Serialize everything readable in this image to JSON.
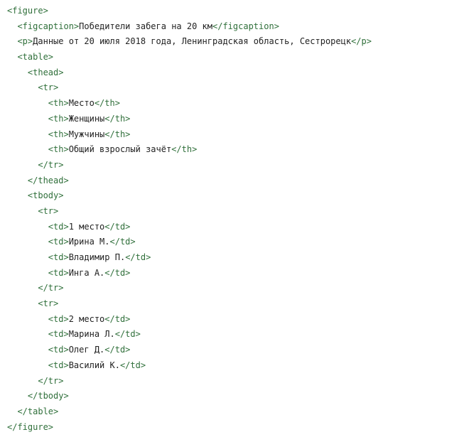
{
  "code": {
    "lines": [
      {
        "indent": 0,
        "open": "<figure>",
        "text": "",
        "close": ""
      },
      {
        "indent": 1,
        "open": "<figcaption>",
        "text": "Победители забега на 20 км",
        "close": "</figcaption>"
      },
      {
        "indent": 1,
        "open": "<p>",
        "text": "Данные от 20 июля 2018 года, Ленинградская область, Сестрорецк",
        "close": "</p>"
      },
      {
        "indent": 1,
        "open": "<table>",
        "text": "",
        "close": ""
      },
      {
        "indent": 2,
        "open": "<thead>",
        "text": "",
        "close": ""
      },
      {
        "indent": 3,
        "open": "<tr>",
        "text": "",
        "close": ""
      },
      {
        "indent": 4,
        "open": "<th>",
        "text": "Место",
        "close": "</th>"
      },
      {
        "indent": 4,
        "open": "<th>",
        "text": "Женщины",
        "close": "</th>"
      },
      {
        "indent": 4,
        "open": "<th>",
        "text": "Мужчины",
        "close": "</th>"
      },
      {
        "indent": 4,
        "open": "<th>",
        "text": "Общий взрослый зачёт",
        "close": "</th>"
      },
      {
        "indent": 3,
        "open": "</tr>",
        "text": "",
        "close": ""
      },
      {
        "indent": 2,
        "open": "</thead>",
        "text": "",
        "close": ""
      },
      {
        "indent": 2,
        "open": "<tbody>",
        "text": "",
        "close": ""
      },
      {
        "indent": 3,
        "open": "<tr>",
        "text": "",
        "close": ""
      },
      {
        "indent": 4,
        "open": "<td>",
        "text": "1 место",
        "close": "</td>"
      },
      {
        "indent": 4,
        "open": "<td>",
        "text": "Ирина М.",
        "close": "</td>"
      },
      {
        "indent": 4,
        "open": "<td>",
        "text": "Владимир П.",
        "close": "</td>"
      },
      {
        "indent": 4,
        "open": "<td>",
        "text": "Инга А.",
        "close": "</td>"
      },
      {
        "indent": 3,
        "open": "</tr>",
        "text": "",
        "close": ""
      },
      {
        "indent": 3,
        "open": "<tr>",
        "text": "",
        "close": ""
      },
      {
        "indent": 4,
        "open": "<td>",
        "text": "2 место",
        "close": "</td>"
      },
      {
        "indent": 4,
        "open": "<td>",
        "text": "Марина Л.",
        "close": "</td>"
      },
      {
        "indent": 4,
        "open": "<td>",
        "text": "Олег Д.",
        "close": "</td>"
      },
      {
        "indent": 4,
        "open": "<td>",
        "text": "Василий К.",
        "close": "</td>"
      },
      {
        "indent": 3,
        "open": "</tr>",
        "text": "",
        "close": ""
      },
      {
        "indent": 2,
        "open": "</tbody>",
        "text": "",
        "close": ""
      },
      {
        "indent": 1,
        "open": "</table>",
        "text": "",
        "close": ""
      },
      {
        "indent": 0,
        "open": "</figure>",
        "text": "",
        "close": ""
      }
    ]
  },
  "colors": {
    "tag": "#2f6f3a",
    "text": "#222222",
    "background": "#ffffff"
  }
}
